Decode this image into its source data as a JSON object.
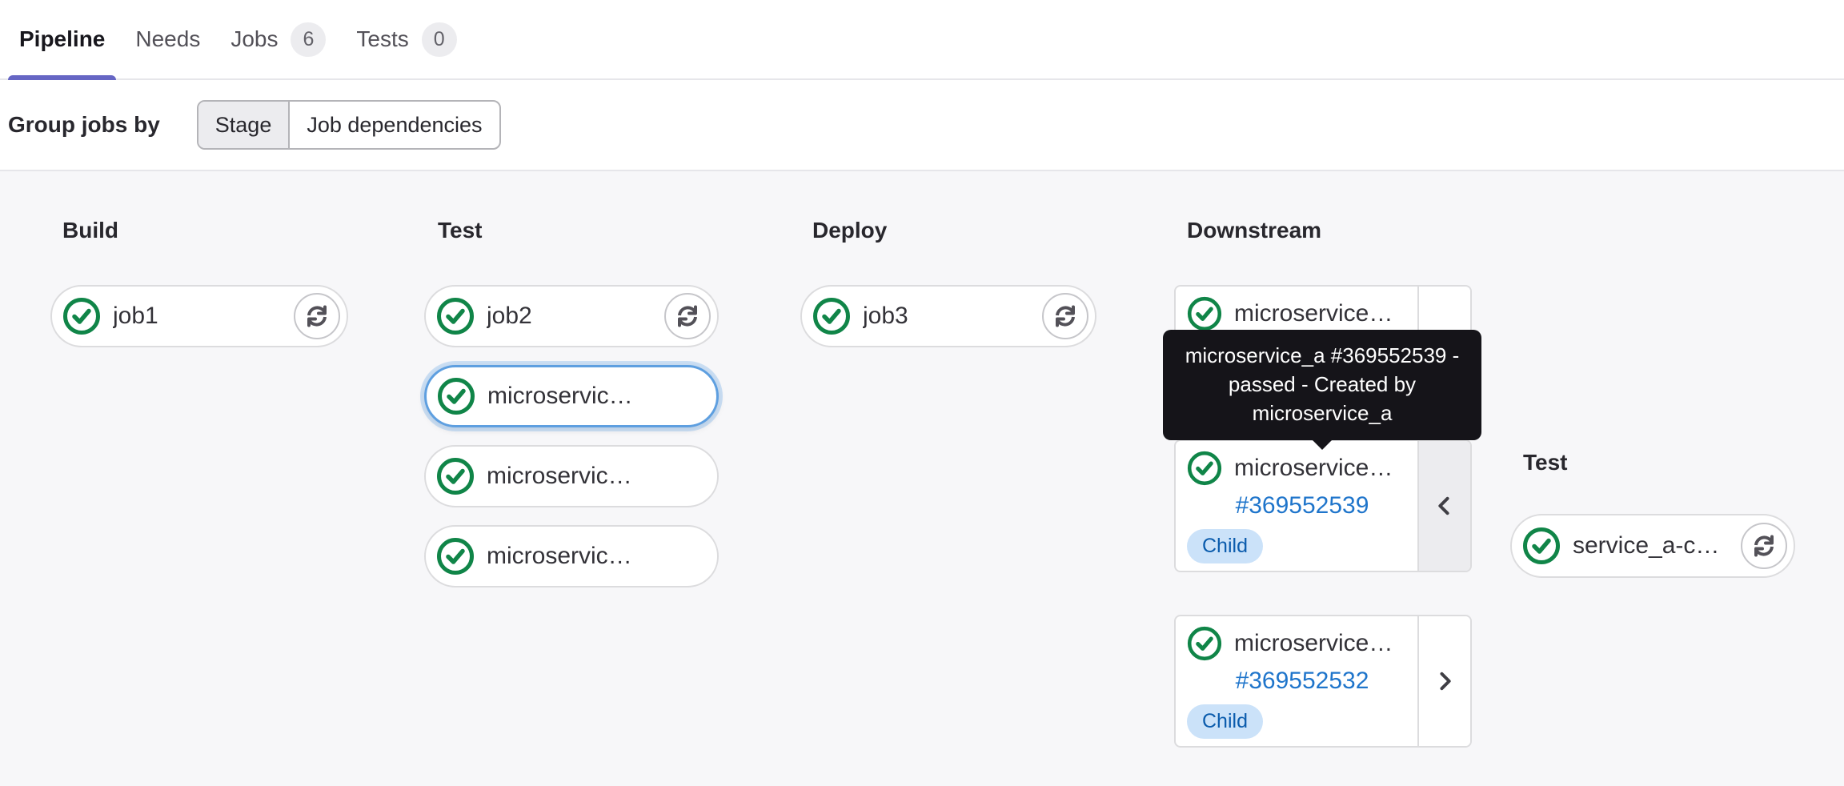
{
  "tabs": {
    "items": [
      {
        "label": "Pipeline",
        "active": true
      },
      {
        "label": "Needs",
        "active": false
      },
      {
        "label": "Jobs",
        "badge": "6",
        "active": false
      },
      {
        "label": "Tests",
        "badge": "0",
        "active": false
      }
    ]
  },
  "toolbar": {
    "group_jobs_by_label": "Group jobs by",
    "segments": [
      {
        "label": "Stage",
        "selected": true
      },
      {
        "label": "Job dependencies",
        "selected": false
      }
    ]
  },
  "pipeline": {
    "stages": [
      {
        "title": "Build",
        "jobs": [
          {
            "name": "job1",
            "status": "passed",
            "retry": true
          }
        ]
      },
      {
        "title": "Test",
        "jobs": [
          {
            "name": "job2",
            "status": "passed",
            "retry": true
          },
          {
            "name": "microservic…",
            "status": "passed",
            "selected": true
          },
          {
            "name": "microservic…",
            "status": "passed"
          },
          {
            "name": "microservic…",
            "status": "passed"
          }
        ]
      },
      {
        "title": "Deploy",
        "jobs": [
          {
            "name": "job3",
            "status": "passed",
            "retry": true
          }
        ]
      }
    ],
    "downstream": {
      "title": "Downstream",
      "pipelines": [
        {
          "name": "microservice…",
          "status": "passed"
        },
        {
          "name": "microservice…",
          "id": "#369552539",
          "badge": "Child",
          "status": "passed",
          "expanded": true
        },
        {
          "name": "microservice…",
          "id": "#369552532",
          "badge": "Child",
          "status": "passed",
          "expanded": false
        }
      ]
    },
    "downstream_stage": {
      "title": "Test",
      "jobs": [
        {
          "name": "service_a-c…",
          "status": "passed",
          "retry": true
        }
      ]
    }
  },
  "tooltip": {
    "lines": [
      "microservice_a #369552539 -",
      "passed - Created by",
      "microservice_a"
    ]
  },
  "colors": {
    "accent_indigo": "#6666c4",
    "success_green": "#108548",
    "link_blue": "#1f75cb",
    "child_badge_bg": "#cbe2f9",
    "child_badge_text": "#0b5cad",
    "tooltip_bg": "#151419",
    "graph_bg": "#f7f7f9",
    "pill_border": "#dcdcde",
    "selected_ring_blue": "#5e9fe0"
  }
}
